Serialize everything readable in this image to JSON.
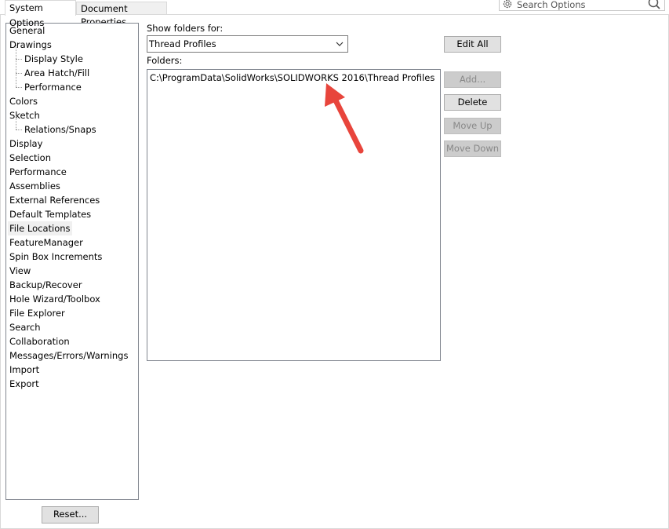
{
  "tabs": [
    {
      "label": "System Options"
    },
    {
      "label": "Document Properties"
    }
  ],
  "search": {
    "placeholder": "Search Options",
    "icon": "search-icon"
  },
  "tree": {
    "items": [
      {
        "label": "General",
        "level": 0
      },
      {
        "label": "Drawings",
        "level": 0
      },
      {
        "label": "Display Style",
        "level": 1
      },
      {
        "label": "Area Hatch/Fill",
        "level": 1
      },
      {
        "label": "Performance",
        "level": 1
      },
      {
        "label": "Colors",
        "level": 0
      },
      {
        "label": "Sketch",
        "level": 0
      },
      {
        "label": "Relations/Snaps",
        "level": 1
      },
      {
        "label": "Display",
        "level": 0
      },
      {
        "label": "Selection",
        "level": 0
      },
      {
        "label": "Performance",
        "level": 0
      },
      {
        "label": "Assemblies",
        "level": 0
      },
      {
        "label": "External References",
        "level": 0
      },
      {
        "label": "Default Templates",
        "level": 0
      },
      {
        "label": "File Locations",
        "level": 0,
        "selected": true
      },
      {
        "label": "FeatureManager",
        "level": 0
      },
      {
        "label": "Spin Box Increments",
        "level": 0
      },
      {
        "label": "View",
        "level": 0
      },
      {
        "label": "Backup/Recover",
        "level": 0
      },
      {
        "label": "Hole Wizard/Toolbox",
        "level": 0
      },
      {
        "label": "File Explorer",
        "level": 0
      },
      {
        "label": "Search",
        "level": 0
      },
      {
        "label": "Collaboration",
        "level": 0
      },
      {
        "label": "Messages/Errors/Warnings",
        "level": 0
      },
      {
        "label": "Import",
        "level": 0
      },
      {
        "label": "Export",
        "level": 0
      }
    ]
  },
  "reset_label": "Reset...",
  "main": {
    "show_folders_label": "Show folders for:",
    "show_folders_value": "Thread Profiles",
    "folders_label": "Folders:",
    "folders": [
      "C:\\ProgramData\\SolidWorks\\SOLIDWORKS 2016\\Thread Profiles"
    ]
  },
  "buttons": {
    "edit_all": "Edit All",
    "add": "Add...",
    "delete": "Delete",
    "move_up": "Move Up",
    "move_down": "Move Down"
  },
  "colors": {
    "annotation_arrow": "#e8453c"
  }
}
